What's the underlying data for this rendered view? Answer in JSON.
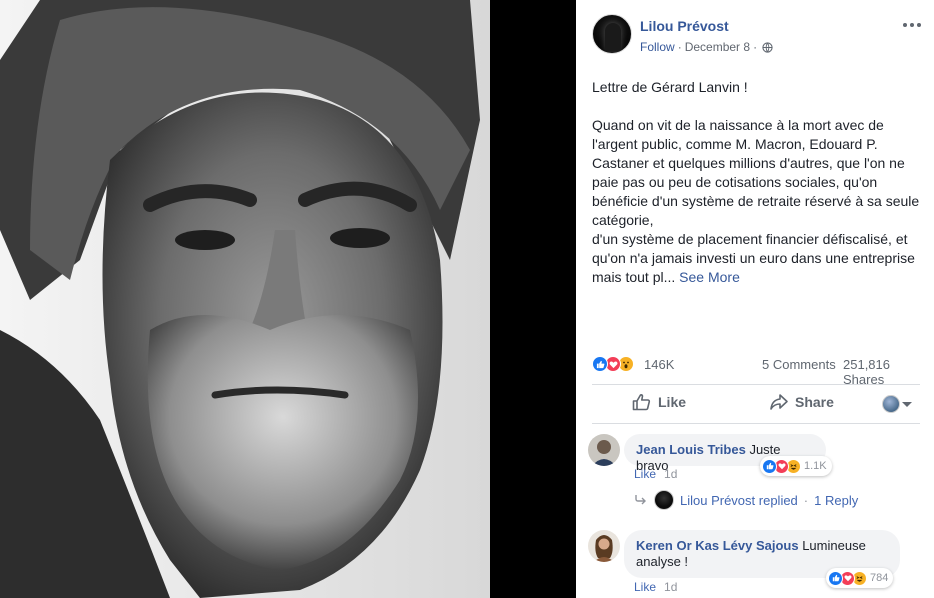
{
  "post": {
    "page_name": "Lilou Prévost",
    "follow_label": "Follow",
    "separator": "·",
    "date": "December 8",
    "privacy_icon": "globe-icon",
    "more_icon": "ellipsis-icon",
    "text_title": "Lettre de Gérard Lanvin !",
    "text_body": "Quand on vit de la naissance à la mort avec de l'argent public, comme M. Macron, Edouard P. Castaner et quelques millions d'autres, que l'on ne paie pas ou peu de cotisations sociales, qu'on bénéficie d'un système de retraite réservé à sa seule catégorie,\nd'un système de placement financier défiscalisé, et qu'on n'a jamais investi un euro dans une entreprise mais tout pl...",
    "see_more": "See More"
  },
  "stats": {
    "reaction_icons": [
      "like",
      "love",
      "wow"
    ],
    "reactions": "146K",
    "comments": "5 Comments",
    "shares": "251,816 Shares"
  },
  "actions": {
    "like": "Like",
    "share": "Share"
  },
  "comments": [
    {
      "author": "Jean Louis Tribes",
      "text": "Juste bravo",
      "like_label": "Like",
      "age": "1d",
      "reaction_icons": [
        "like",
        "love",
        "haha"
      ],
      "reaction_count": "1.1K"
    },
    {
      "author": "Keren Or Kas Lévy Sajous",
      "text": "Lumineuse analyse !",
      "like_label": "Like",
      "age": "1d",
      "reaction_icons": [
        "like",
        "love",
        "haha"
      ],
      "reaction_count": "784"
    }
  ],
  "replies": {
    "who": "Lilou Prévost replied",
    "separator": "·",
    "count": "1 Reply"
  },
  "colors": {
    "link_blue": "#365899",
    "like_blue": "#1877f2",
    "love_red": "#f33e58",
    "wow_yellow": "#f7b125"
  }
}
